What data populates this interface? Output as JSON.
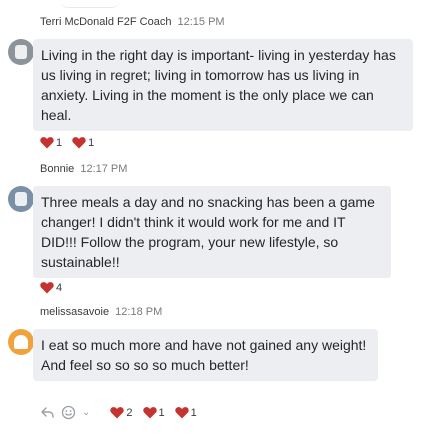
{
  "messages": [
    {
      "author": "Terri McDonald F2F Coach",
      "time": "12:15 PM",
      "text": "Living in the right day is important- living in yesterday has us living in regret; living in tomorrow has us living in anxiety.  Living in the moment is the only place we can heal.",
      "reactions": [
        {
          "icon": "heart-icon",
          "count": "1"
        },
        {
          "icon": "heart-icon",
          "count": "1"
        }
      ]
    },
    {
      "author": "Bonnie",
      "time": "12:17 PM",
      "text": "Three meals a day and no snacking has been a game changer!  I didn't think it would work for me and IT DID!!!  Follow the program, your new lifestyle, so sustainable!!",
      "reactions": [
        {
          "icon": "heart-icon",
          "count": "4"
        }
      ]
    },
    {
      "author": "melissasavoie",
      "time": "12:18 PM",
      "text": "I eat so much more and have not gained any weight! And feel so so so so much better!",
      "reactions": [
        {
          "icon": "heart-icon",
          "count": "2"
        },
        {
          "icon": "heart-icon",
          "count": "1"
        },
        {
          "icon": "heart-icon",
          "count": "1"
        }
      ]
    }
  ],
  "colors": {
    "heart": "#c4332f",
    "bubble": "#eceef1",
    "orange_avatar": "#f2a23c"
  },
  "icons": {
    "reply": "reply-icon",
    "emoji": "emoji-icon",
    "more": "chevron-down-icon"
  }
}
